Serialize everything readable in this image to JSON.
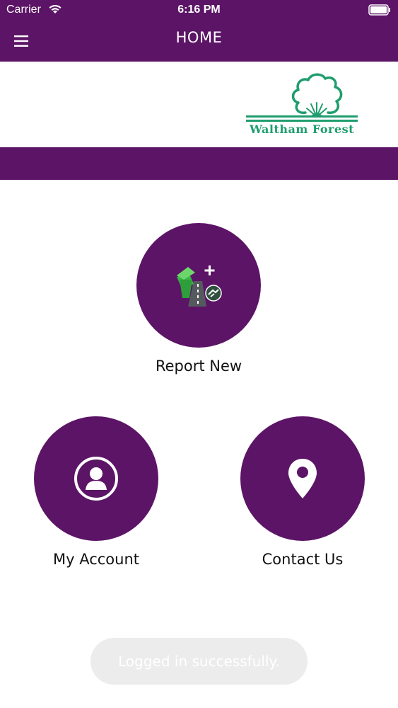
{
  "status_bar": {
    "carrier": "Carrier",
    "time": "6:16 PM"
  },
  "nav": {
    "title": "HOME"
  },
  "logo": {
    "text": "Waltham Forest"
  },
  "tiles": {
    "report_new": {
      "label": "Report New"
    },
    "my_account": {
      "label": "My Account"
    },
    "contact_us": {
      "label": "Contact Us"
    }
  },
  "toast": {
    "message": "Logged in successfully."
  },
  "colors": {
    "brand_purple": "#5c1466",
    "logo_green": "#1f9d6e",
    "toast_bg": "#ececec"
  }
}
